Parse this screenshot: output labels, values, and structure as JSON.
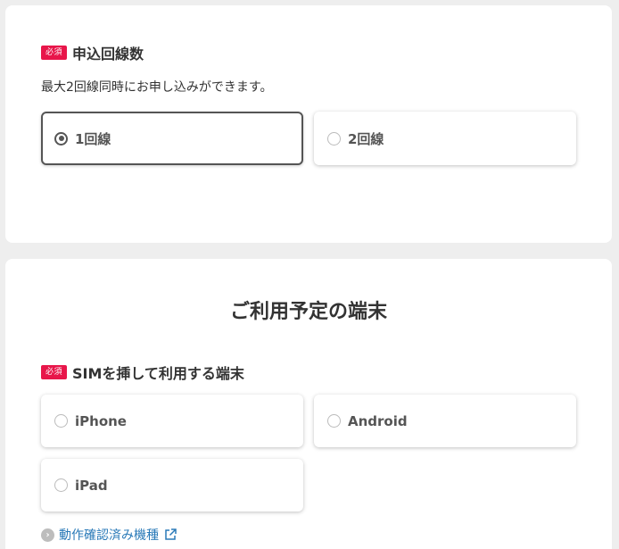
{
  "lines": {
    "badge": "必須",
    "label": "申込回線数",
    "description": "最大2回線同時にお申し込みができます。",
    "options": [
      {
        "label": "1回線",
        "selected": true
      },
      {
        "label": "2回線",
        "selected": false
      }
    ]
  },
  "device": {
    "title": "ご利用予定の端末",
    "badge": "必須",
    "label": "SIMを挿して利用する端末",
    "options": [
      {
        "label": "iPhone",
        "selected": false
      },
      {
        "label": "Android",
        "selected": false
      },
      {
        "label": "iPad",
        "selected": false
      }
    ],
    "link": {
      "label": "動作確認済み機種",
      "icon_left": "chevron-right-circle-icon",
      "icon_right": "external-link-icon"
    }
  },
  "colors": {
    "badge": "#e8164a",
    "link": "#2a7ab8",
    "selected_border": "#555555",
    "page_bg": "#eeeeee"
  }
}
